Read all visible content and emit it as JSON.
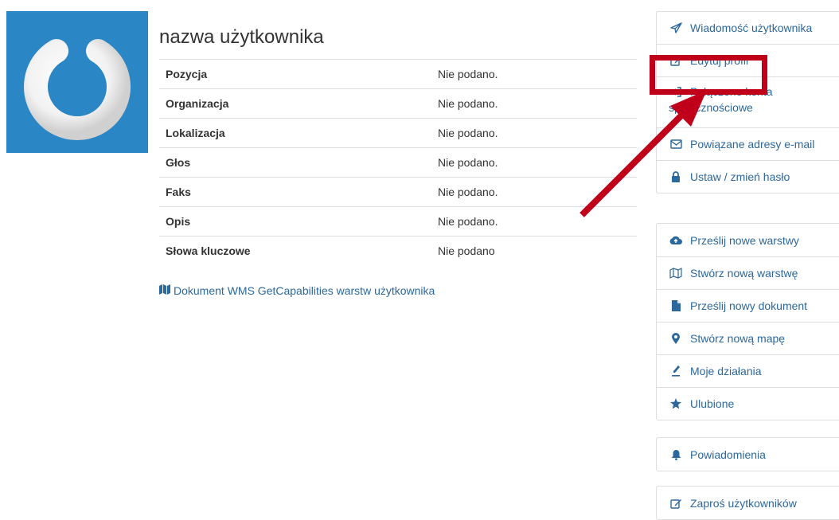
{
  "profile": {
    "username": "nazwa użytkownika",
    "fields": [
      {
        "label": "Pozycja",
        "value": "Nie podano."
      },
      {
        "label": "Organizacja",
        "value": "Nie podano."
      },
      {
        "label": "Lokalizacja",
        "value": "Nie podano."
      },
      {
        "label": "Głos",
        "value": "Nie podano."
      },
      {
        "label": "Faks",
        "value": "Nie podano."
      },
      {
        "label": "Opis",
        "value": "Nie podano."
      },
      {
        "label": "Słowa kluczowe",
        "value": "Nie podano"
      }
    ],
    "wms_link": "Dokument WMS GetCapabilities warstw użytkownika"
  },
  "menu": {
    "account": {
      "message": {
        "label": "Wiadomość użytkownika",
        "icon": "paper-plane-icon"
      },
      "edit_profile": {
        "label": "Edytuj profil",
        "icon": "edit-icon"
      },
      "social_line1": "Połączone konta",
      "social_line2": "społecznościowe",
      "social_icon": "sign-in-icon",
      "emails": {
        "label": "Powiązane adresy e-mail",
        "icon": "envelope-icon"
      },
      "password": {
        "label": "Ustaw / zmień hasło",
        "icon": "lock-icon"
      }
    },
    "actions": {
      "upload_layers": {
        "label": "Prześlij nowe warstwy",
        "icon": "cloud-upload-icon"
      },
      "create_layer": {
        "label": "Stwórz nową warstwę",
        "icon": "map-icon"
      },
      "upload_document": {
        "label": "Prześlij nowy dokument",
        "icon": "file-icon"
      },
      "create_map": {
        "label": "Stwórz nową mapę",
        "icon": "map-marker-icon"
      },
      "my_activity": {
        "label": "Moje działania",
        "icon": "pencil-icon"
      },
      "favorites": {
        "label": "Ulubione",
        "icon": "star-icon"
      }
    },
    "notifications": {
      "label": "Powiadomienia",
      "icon": "bell-icon"
    },
    "invite": {
      "label": "Zaproś użytkowników",
      "icon": "edit-icon"
    }
  },
  "colors": {
    "link": "#2c689c",
    "avatar_bg": "#2a86c4",
    "highlight": "#c0001a"
  }
}
